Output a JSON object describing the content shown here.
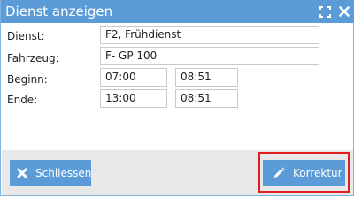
{
  "dialog": {
    "title": "Dienst anzeigen",
    "maximize_icon": "maximize-icon",
    "close_icon": "close-icon"
  },
  "form": {
    "dienst": {
      "label": "Dienst:",
      "value": "F2, Frühdienst"
    },
    "fahrzeug": {
      "label": "Fahrzeug:",
      "value": "F- GP 100"
    },
    "beginn": {
      "label": "Beginn:",
      "value_1": "07:00",
      "value_2": "08:51"
    },
    "ende": {
      "label": "Ende:",
      "value_1": "13:00",
      "value_2": "08:51"
    }
  },
  "footer": {
    "close_button": {
      "label": "Schliessen",
      "icon": "x-icon"
    },
    "correct_button": {
      "label": "Korrektur",
      "icon": "pencil-icon"
    }
  },
  "colors": {
    "title_bar": "#5b9bd8",
    "button": "#5b9bd8",
    "footer": "#e8e8e8",
    "highlight": "#e02020"
  }
}
